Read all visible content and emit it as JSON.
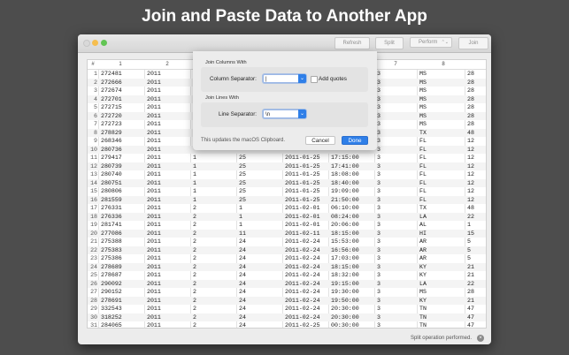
{
  "headline": "Join and Paste Data to Another App",
  "toolbar": {
    "refresh": "Refresh",
    "split": "Split",
    "perform": "Perform",
    "join": "Join"
  },
  "table": {
    "headers": [
      "#",
      "1",
      "2",
      "",
      "",
      "",
      "",
      "7",
      "8"
    ],
    "rows": [
      [
        "1",
        "272481",
        "2011",
        "",
        "",
        "",
        "",
        "3",
        "MS",
        "28"
      ],
      [
        "2",
        "272666",
        "2011",
        "",
        "",
        "",
        "",
        "3",
        "MS",
        "28"
      ],
      [
        "3",
        "272674",
        "2011",
        "",
        "",
        "",
        "",
        "3",
        "MS",
        "28"
      ],
      [
        "4",
        "272701",
        "2011",
        "",
        "",
        "",
        "",
        "3",
        "MS",
        "28"
      ],
      [
        "5",
        "272715",
        "2011",
        "",
        "",
        "",
        "",
        "3",
        "MS",
        "28"
      ],
      [
        "6",
        "272720",
        "2011",
        "",
        "",
        "",
        "",
        "3",
        "MS",
        "28"
      ],
      [
        "7",
        "272723",
        "2011",
        "",
        "",
        "",
        "",
        "3",
        "MS",
        "28"
      ],
      [
        "8",
        "278829",
        "2011",
        "",
        "",
        "",
        "",
        "3",
        "TX",
        "48"
      ],
      [
        "9",
        "268346",
        "2011",
        "",
        "",
        "",
        "",
        "3",
        "FL",
        "12"
      ],
      [
        "10",
        "280736",
        "2011",
        "",
        "",
        "",
        "",
        "3",
        "FL",
        "12"
      ],
      [
        "11",
        "279417",
        "2011",
        "1",
        "25",
        "2011-01-25",
        "17:15:00",
        "3",
        "FL",
        "12"
      ],
      [
        "12",
        "280739",
        "2011",
        "1",
        "25",
        "2011-01-25",
        "17:41:00",
        "3",
        "FL",
        "12"
      ],
      [
        "13",
        "280740",
        "2011",
        "1",
        "25",
        "2011-01-25",
        "18:08:00",
        "3",
        "FL",
        "12"
      ],
      [
        "14",
        "280751",
        "2011",
        "1",
        "25",
        "2011-01-25",
        "18:40:00",
        "3",
        "FL",
        "12"
      ],
      [
        "15",
        "280806",
        "2011",
        "1",
        "25",
        "2011-01-25",
        "19:09:00",
        "3",
        "FL",
        "12"
      ],
      [
        "16",
        "281559",
        "2011",
        "1",
        "25",
        "2011-01-25",
        "21:50:00",
        "3",
        "FL",
        "12"
      ],
      [
        "17",
        "276331",
        "2011",
        "2",
        "1",
        "2011-02-01",
        "06:10:00",
        "3",
        "TX",
        "48"
      ],
      [
        "18",
        "276336",
        "2011",
        "2",
        "1",
        "2011-02-01",
        "08:24:00",
        "3",
        "LA",
        "22"
      ],
      [
        "19",
        "281741",
        "2011",
        "2",
        "1",
        "2011-02-01",
        "20:06:00",
        "3",
        "AL",
        "1"
      ],
      [
        "20",
        "277086",
        "2011",
        "2",
        "11",
        "2011-02-11",
        "18:15:00",
        "3",
        "HI",
        "15"
      ],
      [
        "21",
        "275388",
        "2011",
        "2",
        "24",
        "2011-02-24",
        "15:53:00",
        "3",
        "AR",
        "5"
      ],
      [
        "22",
        "275383",
        "2011",
        "2",
        "24",
        "2011-02-24",
        "16:56:00",
        "3",
        "AR",
        "5"
      ],
      [
        "23",
        "275386",
        "2011",
        "2",
        "24",
        "2011-02-24",
        "17:03:00",
        "3",
        "AR",
        "5"
      ],
      [
        "24",
        "278689",
        "2011",
        "2",
        "24",
        "2011-02-24",
        "18:15:00",
        "3",
        "KY",
        "21"
      ],
      [
        "25",
        "278687",
        "2011",
        "2",
        "24",
        "2011-02-24",
        "18:32:00",
        "3",
        "KY",
        "21"
      ],
      [
        "26",
        "290092",
        "2011",
        "2",
        "24",
        "2011-02-24",
        "19:15:00",
        "3",
        "LA",
        "22"
      ],
      [
        "27",
        "290152",
        "2011",
        "2",
        "24",
        "2011-02-24",
        "19:30:00",
        "3",
        "MS",
        "28"
      ],
      [
        "28",
        "278691",
        "2011",
        "2",
        "24",
        "2011-02-24",
        "19:50:00",
        "3",
        "KY",
        "21"
      ],
      [
        "29",
        "332543",
        "2011",
        "2",
        "24",
        "2011-02-24",
        "20:30:00",
        "3",
        "TN",
        "47"
      ],
      [
        "30",
        "318252",
        "2011",
        "2",
        "24",
        "2011-02-24",
        "20:30:00",
        "3",
        "TN",
        "47"
      ],
      [
        "31",
        "284065",
        "2011",
        "2",
        "24",
        "2011-02-25",
        "00:30:00",
        "3",
        "TN",
        "47"
      ]
    ]
  },
  "dialog": {
    "join_columns_title": "Join Columns With",
    "column_separator_label": "Column Separator:",
    "column_separator_value": "|",
    "add_quotes_label": "Add quotes",
    "join_lines_title": "Join Lines With",
    "line_separator_label": "Line Separator:",
    "line_separator_value": "\\n",
    "note": "This updates the macOS Clipboard.",
    "cancel": "Cancel",
    "done": "Done"
  },
  "status": {
    "message": "Split operation performed."
  },
  "colors": {
    "accent": "#2f7fe8",
    "background": "#4d4d4d"
  }
}
